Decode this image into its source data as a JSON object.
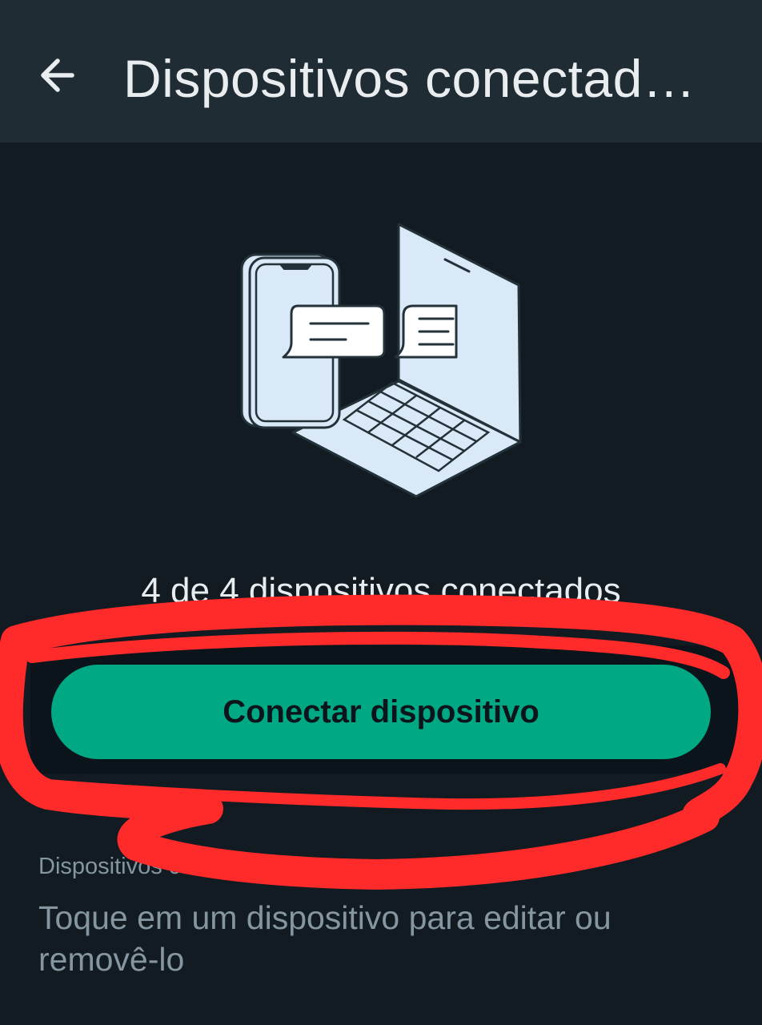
{
  "header": {
    "title": "Dispositivos conectad…",
    "back_icon": "arrow-left-icon"
  },
  "illustration": {
    "icon": "linked-devices-illustration"
  },
  "main": {
    "count_text": "4 de 4 dispositivos conectados",
    "connect_button_label": "Conectar dispositivo",
    "section_label": "Dispositivos cone",
    "hint_text": "Toque em um dispositivo para editar ou removê-lo"
  },
  "annotation": {
    "color": "#ff2a2a",
    "shape": "freehand-circle"
  },
  "colors": {
    "background": "#111b21",
    "app_bar": "#202c33",
    "accent": "#00a884"
  }
}
